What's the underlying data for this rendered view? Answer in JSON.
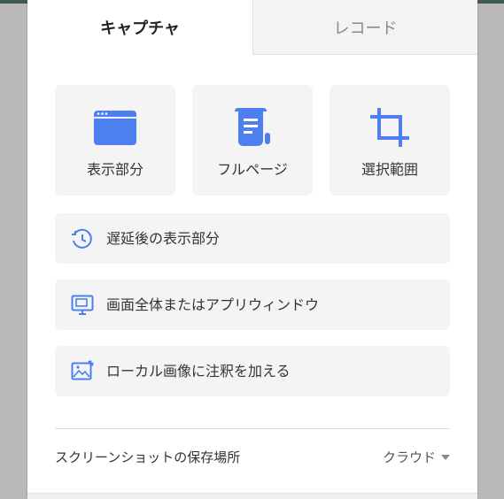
{
  "colors": {
    "accent": "#4d7ff0",
    "card_bg": "#f4f4f4",
    "inactive_tab_bg": "#f3f3f3"
  },
  "tabs": [
    {
      "label": "キャプチャ",
      "active": true
    },
    {
      "label": "レコード",
      "active": false
    }
  ],
  "capture_modes": [
    {
      "label": "表示部分",
      "icon": "browser-window-icon"
    },
    {
      "label": "フルページ",
      "icon": "scroll-page-icon"
    },
    {
      "label": "選択範囲",
      "icon": "crop-icon"
    }
  ],
  "options": [
    {
      "label": "遅延後の表示部分",
      "icon": "timer-icon"
    },
    {
      "label": "画面全体またはアプリウィンドウ",
      "icon": "monitor-icon"
    },
    {
      "label": "ローカル画像に注釈を加える",
      "icon": "image-edit-icon"
    }
  ],
  "footer": {
    "label": "スクリーンショットの保存場所",
    "selected": "クラウド",
    "dropdown_icon": "caret-down-icon"
  }
}
